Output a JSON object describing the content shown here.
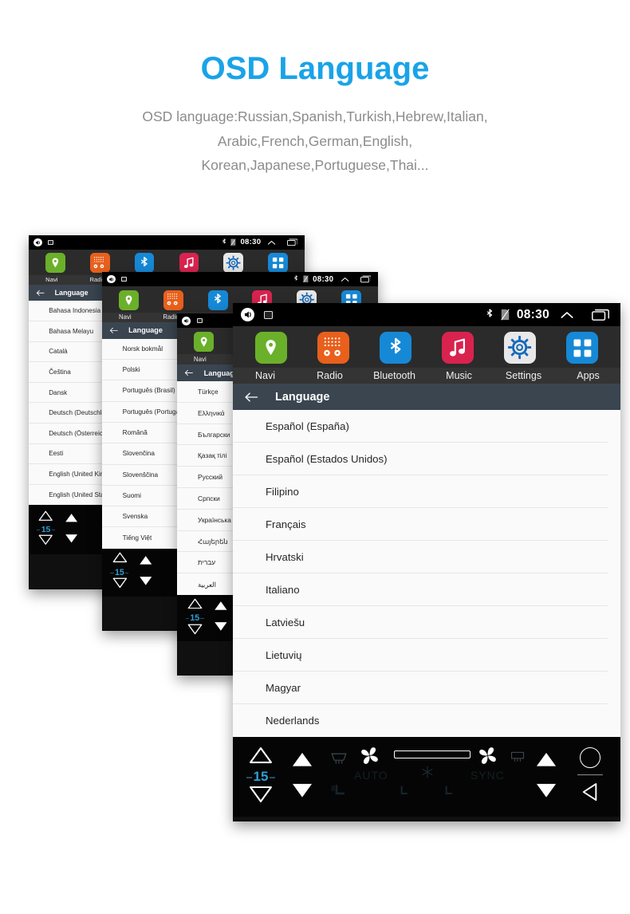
{
  "header": {
    "title": "OSD Language",
    "subtitle_lines": [
      "OSD language:Russian,Spanish,Turkish,Hebrew,Italian,",
      "Arabic,French,German,English,",
      "Korean,Japanese,Portuguese,Thai..."
    ],
    "title_color": "#1aa3e8",
    "subtitle_color": "#8c8c8c"
  },
  "statusbar": {
    "time": "08:30",
    "icons_left": [
      "volume-icon",
      "screenshot-icon"
    ],
    "icons_right": [
      "bluetooth-icon",
      "no-sim-icon",
      "chevron-up-icon",
      "recents-icon"
    ]
  },
  "dock": {
    "apps": [
      {
        "label": "Navi",
        "icon": "location-pin-icon",
        "color": "#6bb02a"
      },
      {
        "label": "Radio",
        "icon": "radio-icon",
        "color": "#e8601c"
      },
      {
        "label": "Bluetooth",
        "icon": "bluetooth-icon",
        "color": "#1689d6"
      },
      {
        "label": "Music",
        "icon": "music-note-icon",
        "color": "#d9234f"
      },
      {
        "label": "Settings",
        "icon": "gear-icon",
        "color": "#e8e8e8"
      },
      {
        "label": "Apps",
        "icon": "grid-apps-icon",
        "color": "#1689d6"
      }
    ]
  },
  "titlebar": {
    "back_icon": "arrow-left-icon",
    "title": "Language"
  },
  "hardware": {
    "temperature": "15",
    "labels": {
      "auto": "AUTO",
      "sync": "SYNC"
    },
    "buttons": [
      "temp-up-triangle",
      "temp-down-triangle",
      "fan-up-triangle",
      "fan-down-triangle",
      "front-defrost-icon",
      "fan-left-icon",
      "seat-slider",
      "snowflake-icon",
      "fan-right-icon",
      "rear-defrost-icon",
      "volume-up-triangle",
      "volume-down-triangle",
      "power-circle-button",
      "back-triangle-button"
    ]
  },
  "panels": [
    {
      "id": "panel-1",
      "languages": [
        "Bahasa Indonesia",
        "Bahasa Melayu",
        "Català",
        "Čeština",
        "Dansk",
        "Deutsch (Deutschland)",
        "Deutsch (Österreich)",
        "Eesti",
        "English (United Kingdom)",
        "English (United States)"
      ]
    },
    {
      "id": "panel-2",
      "languages": [
        "Norsk bokmål",
        "Polski",
        "Português (Brasil)",
        "Português (Portugal)",
        "Română",
        "Slovenčina",
        "Slovenščina",
        "Suomi",
        "Svenska",
        "Tiếng Việt"
      ]
    },
    {
      "id": "panel-3",
      "languages": [
        "Türkçe",
        "Ελληνικά",
        "Български",
        "Қазақ тілі",
        "Русский",
        "Српски",
        "Українська",
        "Հայերեն",
        "עברית",
        "العربية"
      ]
    },
    {
      "id": "panel-4",
      "languages": [
        "Español (España)",
        "Español (Estados Unidos)",
        "Filipino",
        "Français",
        "Hrvatski",
        "Italiano",
        "Latviešu",
        "Lietuvių",
        "Magyar",
        "Nederlands"
      ]
    }
  ]
}
